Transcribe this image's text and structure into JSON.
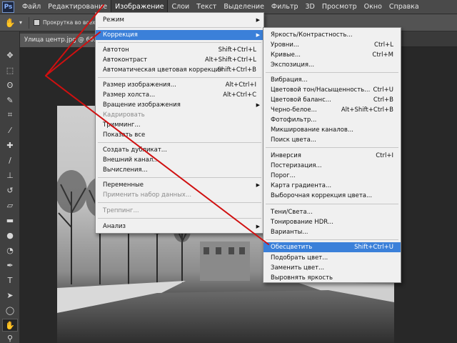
{
  "app": {
    "logo": "Ps"
  },
  "menubar": {
    "items": [
      "Файл",
      "Редактирование",
      "Изображение",
      "Слои",
      "Текст",
      "Выделение",
      "Фильтр",
      "3D",
      "Просмотр",
      "Окно",
      "Справка"
    ],
    "active": "Изображение"
  },
  "options_bar": {
    "scroll_all_label": "Прокрутка во всех окнах"
  },
  "document_tab": {
    "label": "Улица центр.jpg @ 66.7%"
  },
  "image_menu": {
    "mode": "Режим",
    "adjustments": "Коррекция",
    "autotone": {
      "label": "Автотон",
      "shortcut": "Shift+Ctrl+L"
    },
    "autocontrast": {
      "label": "Автоконтраст",
      "shortcut": "Alt+Shift+Ctrl+L"
    },
    "autocolor": {
      "label": "Автоматическая цветовая коррекция",
      "shortcut": "Shift+Ctrl+B"
    },
    "image_size": {
      "label": "Размер изображения...",
      "shortcut": "Alt+Ctrl+I"
    },
    "canvas_size": {
      "label": "Размер холста...",
      "shortcut": "Alt+Ctrl+C"
    },
    "rotation": "Вращение изображения",
    "crop": "Кадрировать",
    "trim": "Тримминг...",
    "reveal_all": "Показать все",
    "duplicate": "Создать дубликат...",
    "apply_image": "Внешний канал...",
    "calculations": "Вычисления...",
    "variables": "Переменные",
    "apply_data_set": "Применить набор данных...",
    "trap": "Треппинг...",
    "analysis": "Анализ"
  },
  "adjustments_menu": {
    "brightness_contrast": "Яркость/Контрастность...",
    "levels": {
      "label": "Уровни...",
      "shortcut": "Ctrl+L"
    },
    "curves": {
      "label": "Кривые...",
      "shortcut": "Ctrl+M"
    },
    "exposure": "Экспозиция...",
    "vibrance": "Вибрация...",
    "hue_saturation": {
      "label": "Цветовой тон/Насыщенность...",
      "shortcut": "Ctrl+U"
    },
    "color_balance": {
      "label": "Цветовой баланс...",
      "shortcut": "Ctrl+B"
    },
    "black_white": {
      "label": "Черно-белое...",
      "shortcut": "Alt+Shift+Ctrl+B"
    },
    "photo_filter": "Фотофильтр...",
    "channel_mixer": "Микширование каналов...",
    "color_lookup": "Поиск цвета...",
    "invert": {
      "label": "Инверсия",
      "shortcut": "Ctrl+I"
    },
    "posterize": "Постеризация...",
    "threshold": "Порог...",
    "gradient_map": "Карта градиента...",
    "selective_color": "Выборочная коррекция цвета...",
    "shadows_highlights": "Тени/Света...",
    "hdr_toning": "Тонирование HDR...",
    "variations": "Варианты...",
    "desaturate": {
      "label": "Обесцветить",
      "shortcut": "Shift+Ctrl+U"
    },
    "match_color": "Подобрать цвет...",
    "replace_color": "Заменить цвет...",
    "equalize": "Выровнять яркость"
  },
  "colors": {
    "highlight": "#3b80d9",
    "annotation": "#d01010"
  }
}
